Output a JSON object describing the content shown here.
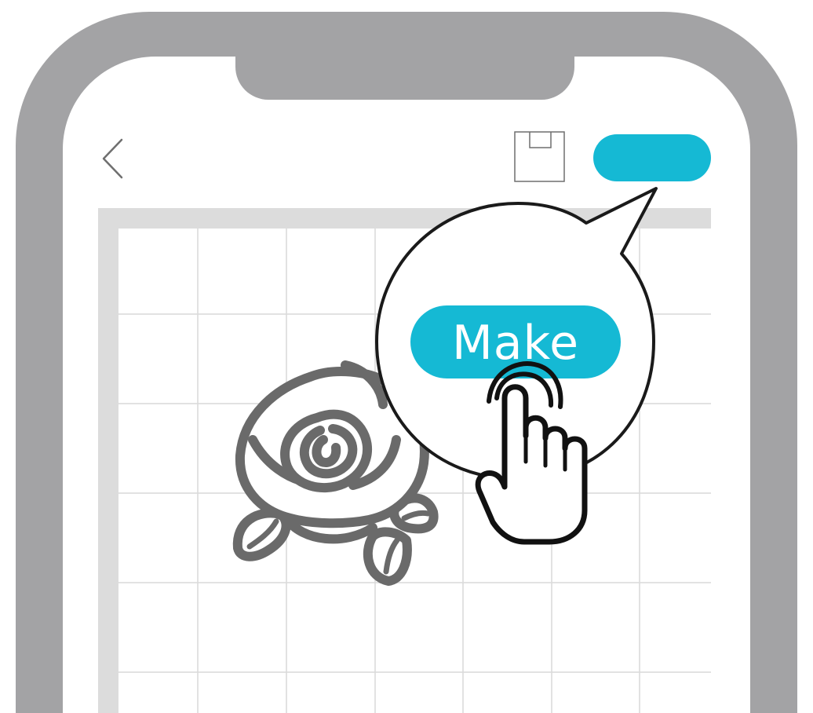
{
  "app": {
    "zoom_button_label": "Make"
  },
  "colors": {
    "phone_frame": "#a3a3a5",
    "screen": "#ffffff",
    "accent": "#15b9d4",
    "mat_border": "#dcdcdc",
    "grid_line": "#d9d9d9",
    "rose": "#6a6a6a",
    "outline": "#1a1a1a"
  },
  "icons": {
    "back": "chevron-left-icon",
    "save": "save-icon",
    "artwork": "rose-icon",
    "pointer": "hand-pointer-icon"
  }
}
